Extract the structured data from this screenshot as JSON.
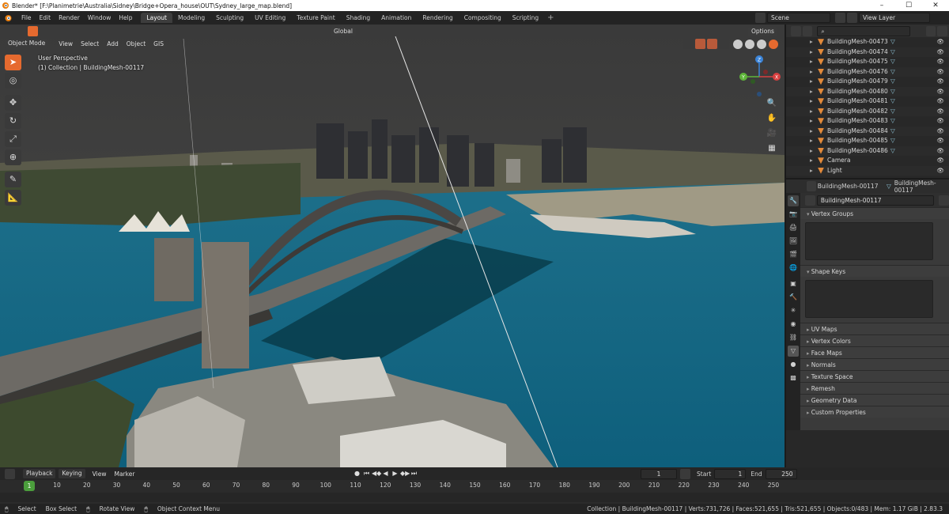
{
  "window": {
    "title": "Blender* [F:\\Planimetrie\\Australia\\Sidney\\Bridge+Opera_house\\OUT\\Sydney_large_map.blend]",
    "controls": [
      "–",
      "☐",
      "✕"
    ]
  },
  "topbar": {
    "menus": [
      "File",
      "Edit",
      "Render",
      "Window",
      "Help"
    ],
    "workspaces": [
      "Layout",
      "Modeling",
      "Sculpting",
      "UV Editing",
      "Texture Paint",
      "Shading",
      "Animation",
      "Rendering",
      "Compositing",
      "Scripting"
    ],
    "active_workspace": "Layout",
    "add_workspace": "+",
    "scene": "Scene",
    "view_layer": "View Layer"
  },
  "viewport": {
    "mode": "Object Mode",
    "menus": [
      "View",
      "Select",
      "Add",
      "Object",
      "GIS"
    ],
    "transform_orientation": "Global",
    "options": "Options",
    "perspective_label": "User Perspective",
    "collection_label": "(1) Collection | BuildingMesh-00117",
    "gizmo_axes": [
      "Z",
      "X",
      "Y"
    ]
  },
  "outliner": {
    "search_placeholder": "",
    "rows": [
      {
        "name": "BuildingMesh-00473"
      },
      {
        "name": "BuildingMesh-00474"
      },
      {
        "name": "BuildingMesh-00475"
      },
      {
        "name": "BuildingMesh-00476"
      },
      {
        "name": "BuildingMesh-00479"
      },
      {
        "name": "BuildingMesh-00480"
      },
      {
        "name": "BuildingMesh-00481"
      },
      {
        "name": "BuildingMesh-00482"
      },
      {
        "name": "BuildingMesh-00483"
      },
      {
        "name": "BuildingMesh-00484"
      },
      {
        "name": "BuildingMesh-00485"
      },
      {
        "name": "BuildingMesh-00486"
      },
      {
        "name": "Camera"
      },
      {
        "name": "Light"
      }
    ]
  },
  "properties": {
    "object_name": "BuildingMesh-00117",
    "mesh_name": "BuildingMesh-00117",
    "data_name": "BuildingMesh-00117",
    "panels": {
      "vertex_groups": "Vertex Groups",
      "shape_keys": "Shape Keys",
      "uv_maps": "UV Maps",
      "vertex_colors": "Vertex Colors",
      "face_maps": "Face Maps",
      "normals": "Normals",
      "texture_space": "Texture Space",
      "remesh": "Remesh",
      "geometry_data": "Geometry Data",
      "custom_properties": "Custom Properties"
    }
  },
  "timeline": {
    "menus": [
      "Playback",
      "Keying",
      "View",
      "Marker"
    ],
    "current_frame": "1",
    "current_frame_field": "1",
    "start_label": "Start",
    "start": "1",
    "end_label": "End",
    "end": "250",
    "ticks": [
      "10",
      "20",
      "30",
      "40",
      "50",
      "60",
      "70",
      "80",
      "90",
      "100",
      "110",
      "120",
      "130",
      "140",
      "150",
      "160",
      "170",
      "180",
      "190",
      "200",
      "210",
      "220",
      "230",
      "240",
      "250"
    ]
  },
  "statusbar": {
    "select": "Select",
    "box_select": "Box Select",
    "rotate_view": "Rotate View",
    "context_menu": "Object Context Menu",
    "stats": "Collection | BuildingMesh-00117 | Verts:731,726 | Faces:521,655 | Tris:521,655 | Objects:0/483 | Mem: 1.17 GiB | 2.83.3"
  }
}
